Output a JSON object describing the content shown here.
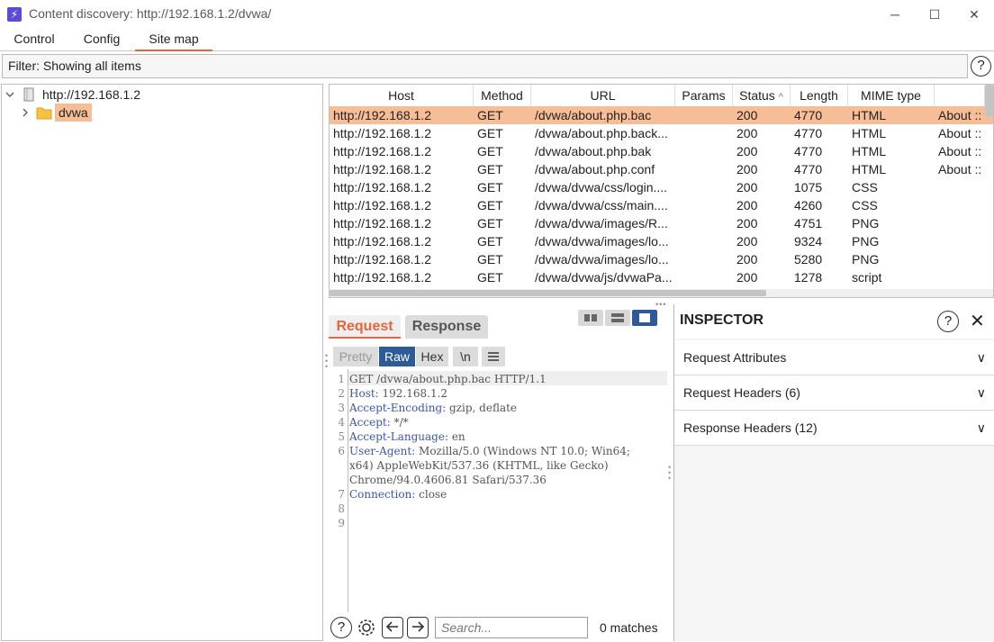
{
  "window": {
    "title": "Content discovery: http://192.168.1.2/dvwa/",
    "app_icon": "lightning-icon",
    "minimize_label": "─",
    "maximize_label": "☐",
    "close_label": "✕"
  },
  "tabs": [
    {
      "label": "Control"
    },
    {
      "label": "Config"
    },
    {
      "label": "Site map",
      "active": true
    }
  ],
  "filter": {
    "text": "Filter: Showing all items",
    "help": "?"
  },
  "tree": {
    "root": {
      "label": "http://192.168.1.2",
      "expanded": true
    },
    "child": {
      "label": "dvwa",
      "selected": true
    }
  },
  "table": {
    "columns": [
      "Host",
      "Method",
      "URL",
      "Params",
      "Status",
      "Length",
      "MIME type",
      ""
    ],
    "sort_indicator": "^",
    "rows": [
      {
        "host": "http://192.168.1.2",
        "method": "GET",
        "url": "/dvwa/about.php.bac",
        "params": "",
        "status": "200",
        "length": "4770",
        "mime": "HTML",
        "title": "About ::"
      },
      {
        "host": "http://192.168.1.2",
        "method": "GET",
        "url": "/dvwa/about.php.back...",
        "params": "",
        "status": "200",
        "length": "4770",
        "mime": "HTML",
        "title": "About ::"
      },
      {
        "host": "http://192.168.1.2",
        "method": "GET",
        "url": "/dvwa/about.php.bak",
        "params": "",
        "status": "200",
        "length": "4770",
        "mime": "HTML",
        "title": "About ::"
      },
      {
        "host": "http://192.168.1.2",
        "method": "GET",
        "url": "/dvwa/about.php.conf",
        "params": "",
        "status": "200",
        "length": "4770",
        "mime": "HTML",
        "title": "About ::"
      },
      {
        "host": "http://192.168.1.2",
        "method": "GET",
        "url": "/dvwa/dvwa/css/login....",
        "params": "",
        "status": "200",
        "length": "1075",
        "mime": "CSS",
        "title": ""
      },
      {
        "host": "http://192.168.1.2",
        "method": "GET",
        "url": "/dvwa/dvwa/css/main....",
        "params": "",
        "status": "200",
        "length": "4260",
        "mime": "CSS",
        "title": ""
      },
      {
        "host": "http://192.168.1.2",
        "method": "GET",
        "url": "/dvwa/dvwa/images/R...",
        "params": "",
        "status": "200",
        "length": "4751",
        "mime": "PNG",
        "title": ""
      },
      {
        "host": "http://192.168.1.2",
        "method": "GET",
        "url": "/dvwa/dvwa/images/lo...",
        "params": "",
        "status": "200",
        "length": "9324",
        "mime": "PNG",
        "title": ""
      },
      {
        "host": "http://192.168.1.2",
        "method": "GET",
        "url": "/dvwa/dvwa/images/lo...",
        "params": "",
        "status": "200",
        "length": "5280",
        "mime": "PNG",
        "title": ""
      },
      {
        "host": "http://192.168.1.2",
        "method": "GET",
        "url": "/dvwa/dvwa/js/dvwaPa...",
        "params": "",
        "status": "200",
        "length": "1278",
        "mime": "script",
        "title": ""
      }
    ]
  },
  "message": {
    "tabs": [
      {
        "label": "Request",
        "active": true
      },
      {
        "label": "Response"
      }
    ],
    "format_buttons": [
      "Pretty",
      "Raw",
      "Hex",
      "\\n"
    ],
    "active_format": "Raw",
    "lines": [
      {
        "n": "1",
        "key": "",
        "value": "GET /dvwa/about.php.bac HTTP/1.1"
      },
      {
        "n": "2",
        "key": "Host:",
        "value": " 192.168.1.2"
      },
      {
        "n": "3",
        "key": "Accept-Encoding:",
        "value": " gzip, deflate"
      },
      {
        "n": "4",
        "key": "Accept:",
        "value": " */*"
      },
      {
        "n": "5",
        "key": "Accept-Language:",
        "value": " en"
      },
      {
        "n": "6",
        "key": "User-Agent:",
        "value": " Mozilla/5.0 (Windows NT 10.0; Win64;"
      },
      {
        "n": "",
        "key": "",
        "value": "x64) AppleWebKit/537.36 (KHTML, like Gecko)"
      },
      {
        "n": "",
        "key": "",
        "value": "Chrome/94.0.4606.81 Safari/537.36"
      },
      {
        "n": "7",
        "key": "Connection:",
        "value": " close"
      },
      {
        "n": "8",
        "key": "",
        "value": ""
      },
      {
        "n": "9",
        "key": "",
        "value": ""
      }
    ],
    "search_placeholder": "Search...",
    "matches": "0 matches"
  },
  "inspector": {
    "title": "INSPECTOR",
    "sections": [
      {
        "label": "Request Attributes"
      },
      {
        "label": "Request Headers (6)"
      },
      {
        "label": "Response Headers (12)"
      }
    ]
  },
  "colors": {
    "accent": "#e8643b",
    "selected_row": "#f7bd96",
    "folder": "#f5c242",
    "header_key": "#3a55b0"
  }
}
